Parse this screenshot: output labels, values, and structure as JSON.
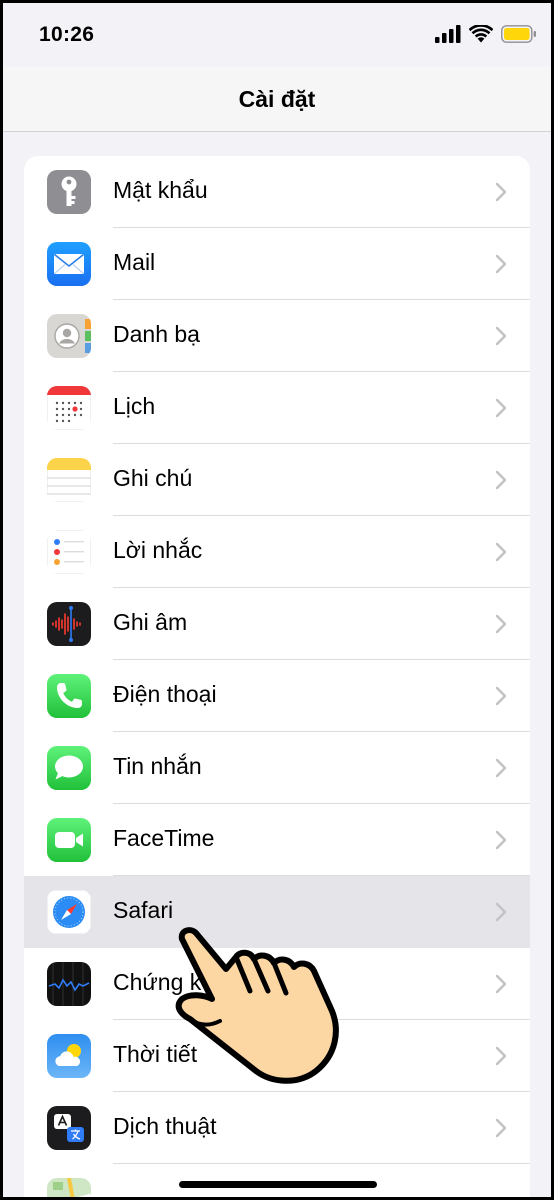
{
  "status_bar": {
    "time": "10:26",
    "icons": [
      "cellular-signal-icon",
      "wifi-icon",
      "battery-icon"
    ],
    "battery_color": "#FFD60A"
  },
  "nav": {
    "title": "Cài đặt"
  },
  "settings_items": [
    {
      "label": "Mật khẩu",
      "icon": "key-icon"
    },
    {
      "label": "Mail",
      "icon": "mail-icon"
    },
    {
      "label": "Danh bạ",
      "icon": "contacts-icon"
    },
    {
      "label": "Lịch",
      "icon": "calendar-icon"
    },
    {
      "label": "Ghi chú",
      "icon": "notes-icon"
    },
    {
      "label": "Lời nhắc",
      "icon": "reminders-icon"
    },
    {
      "label": "Ghi âm",
      "icon": "voice-memos-icon"
    },
    {
      "label": "Điện thoại",
      "icon": "phone-icon"
    },
    {
      "label": "Tin nhắn",
      "icon": "messages-icon"
    },
    {
      "label": "FaceTime",
      "icon": "facetime-icon"
    },
    {
      "label": "Safari",
      "icon": "safari-icon",
      "selected": true
    },
    {
      "label": "Chứng k",
      "icon": "stocks-icon"
    },
    {
      "label": "Thời tiết",
      "icon": "weather-icon"
    },
    {
      "label": "Dịch thuật",
      "icon": "translate-icon"
    },
    {
      "label": "",
      "icon": "maps-icon"
    }
  ],
  "overlay": {
    "icon": "pointing-hand-icon"
  },
  "colors": {
    "selected_row": "#E4E4E9",
    "chevron": "#C4C4C7",
    "page_bg": "#F2F2F7"
  }
}
